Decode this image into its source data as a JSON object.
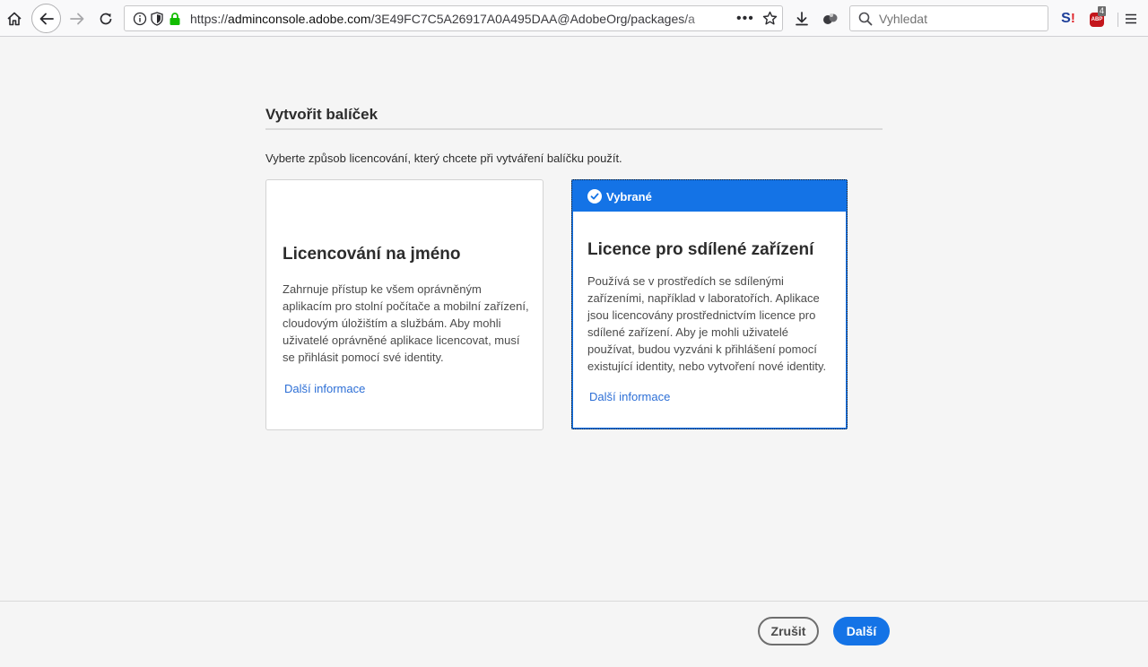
{
  "browser": {
    "url_protocol": "https://",
    "url_host": "adminconsole.adobe.com",
    "url_path": "/3E49FC7C5A26917A0A495DAA@AdobeOrg/packages/a",
    "search_placeholder": "Vyhledat",
    "abp_badge": "4",
    "abp_label": "ABP",
    "ext_s_label": "S"
  },
  "page": {
    "title": "Vytvořit balíček",
    "description": "Vyberte způsob licencování, který chcete při vytváření balíčku použít."
  },
  "cards": [
    {
      "title": "Licencování na jméno",
      "body": "Zahrnuje přístup ke všem oprávněným aplikacím pro stolní počítače a mobilní zařízení, cloudovým úložištím a službám. Aby mohli uživatelé oprávněné aplikace licencovat, musí se přihlásit pomocí své identity.",
      "link": "Další informace"
    },
    {
      "selected_label": "Vybrané",
      "title": "Licence pro sdílené zařízení",
      "body": "Používá se v prostředích se sdílenými zařízeními, například v laboratořích. Aplikace jsou licencovány prostřednictvím licence pro sdílené zařízení. Aby je mohli uživatelé používat, budou vyzváni k přihlášení pomocí existující identity, nebo vytvoření nové identity.",
      "link": "Další informace"
    }
  ],
  "footer": {
    "cancel_label": "Zrušit",
    "next_label": "Další"
  },
  "colors": {
    "accent": "#1473e6",
    "link": "#2d6fd6",
    "lock_green": "#12bc00"
  }
}
